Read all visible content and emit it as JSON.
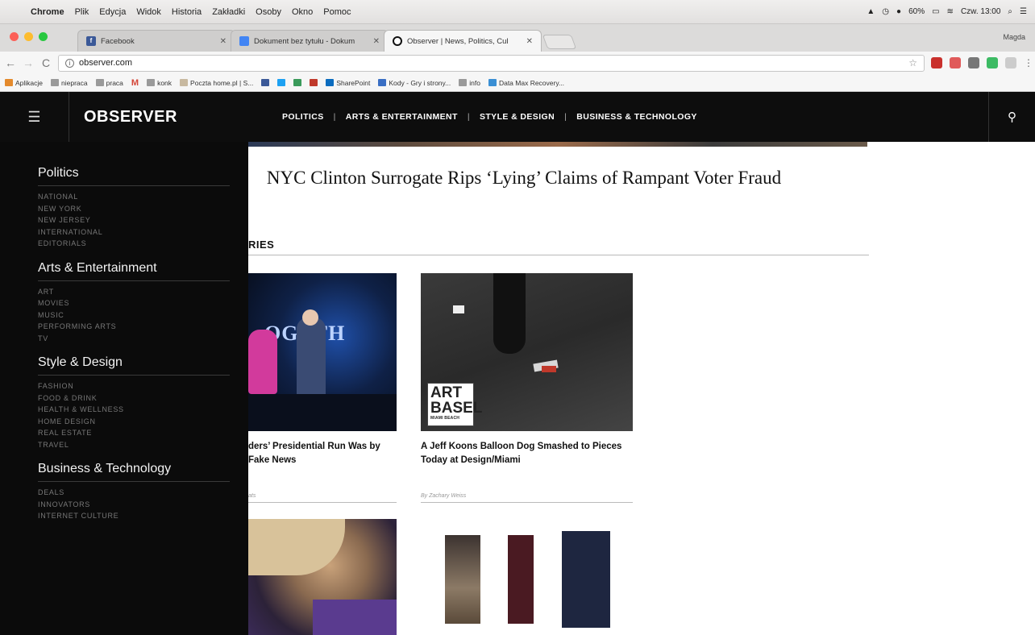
{
  "menubar": {
    "items": [
      "Chrome",
      "Plik",
      "Edycja",
      "Widok",
      "Historia",
      "Zakładki",
      "Osoby",
      "Okno",
      "Pomoc"
    ],
    "battery": "60%",
    "clock": "Czw. 13:00"
  },
  "tabs": [
    {
      "title": "Facebook",
      "favicon_color": "#3b5998",
      "favicon_letter": "f"
    },
    {
      "title": "Dokument bez tytułu - Dokum",
      "favicon_color": "#4285f4",
      "favicon_letter": ""
    },
    {
      "title": "Observer | News, Politics, Cul",
      "favicon_color": "#111111",
      "favicon_letter": ""
    }
  ],
  "profile_name": "Magda",
  "address": {
    "url": "observer.com"
  },
  "bookmarks": [
    "Aplikacje",
    "nieprаca",
    "praca",
    "M",
    "konk",
    "Poczta home.pl | S...",
    "",
    "",
    "",
    "",
    "SharePoint",
    "Kody - Gry i strony...",
    "info",
    "Data Max Recovery..."
  ],
  "site": {
    "logo": "OBSERVER",
    "nav": [
      "POLITICS",
      "ARTS & ENTERTAINMENT",
      "STYLE & DESIGN",
      "BUSINESS & TECHNOLOGY"
    ],
    "separator": "|"
  },
  "drawer": [
    {
      "title": "Politics",
      "items": [
        "NATIONAL",
        "NEW YORK",
        "NEW JERSEY",
        "INTERNATIONAL",
        "EDITORIALS"
      ]
    },
    {
      "title": "Arts & Entertainment",
      "items": [
        "ART",
        "MOVIES",
        "MUSIC",
        "PERFORMING ARTS",
        "TV"
      ]
    },
    {
      "title": "Style & Design",
      "items": [
        "FASHION",
        "FOOD & DRINK",
        "HEALTH & WELLNESS",
        "HOME DESIGN",
        "REAL ESTATE",
        "TRAVEL"
      ]
    },
    {
      "title": "Business & Technology",
      "items": [
        "DEALS",
        "INNOVATORS",
        "INTERNET CULTURE"
      ]
    }
  ],
  "main": {
    "headline": "NYC Clinton Surrogate Rips ‘Lying’ Claims of Rampant Voter Fraud",
    "section_label": "RIES",
    "cards": [
      {
        "title": "ders’ Presidential Run Was by Fake News",
        "byline": "ats"
      },
      {
        "title": "A Jeff Koons Balloon Dog Smashed to Pieces Today at Design/Miami",
        "byline": "By Zachary Weiss",
        "overlay_lines": [
          "ART",
          "BASEL"
        ],
        "overlay_small": "MIAMI BEACH"
      }
    ],
    "poster_text": "OGETH"
  }
}
